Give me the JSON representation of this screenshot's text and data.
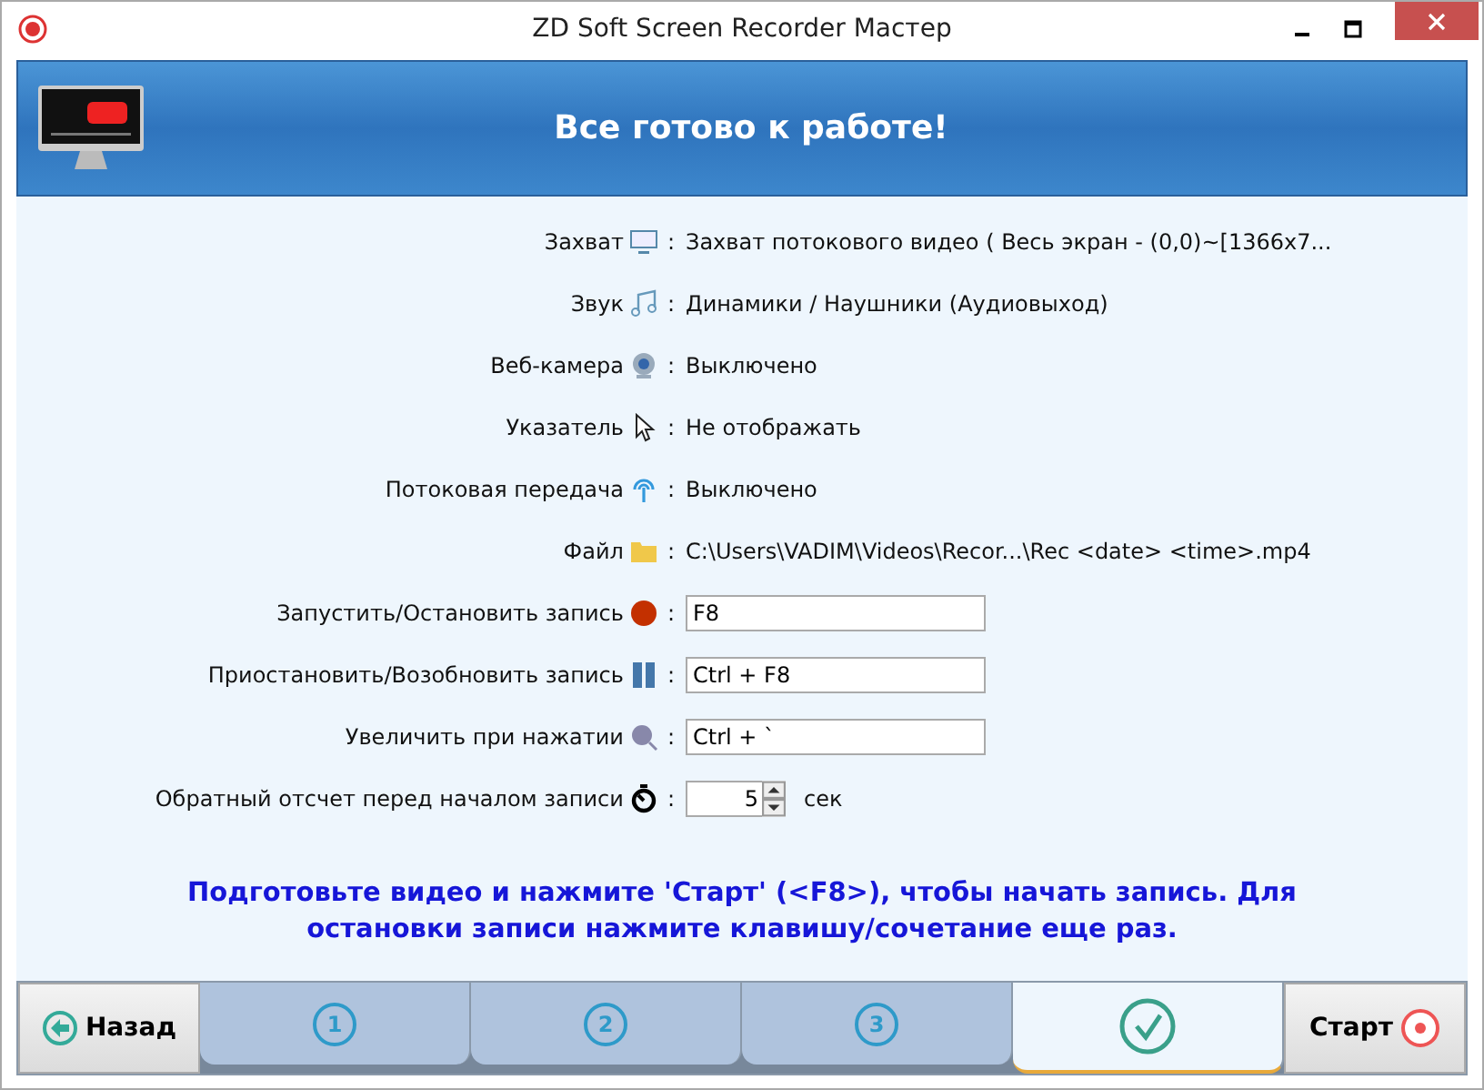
{
  "window": {
    "title": "ZD Soft Screen Recorder Мастер"
  },
  "banner": {
    "title": "Все готово к работе!"
  },
  "rows": [
    {
      "kind": "info",
      "label": "Захват",
      "colon": ":",
      "value": "Захват потокового видео ( Весь экран - (0,0)~[1366x7..."
    },
    {
      "kind": "info",
      "label": "Звук",
      "colon": ":",
      "value": "Динамики / Наушники (Аудиовыход)"
    },
    {
      "kind": "info",
      "label": "Веб-камера",
      "colon": ":",
      "value": "Выключено"
    },
    {
      "kind": "info",
      "label": "Указатель",
      "colon": ":",
      "value": "Не отображать"
    },
    {
      "kind": "info",
      "label": "Потоковая передача",
      "colon": ":",
      "value": "Выключено"
    },
    {
      "kind": "info",
      "label": "Файл",
      "colon": ":",
      "value": "C:\\Users\\VADIM\\Videos\\Recor...\\Rec <date> <time>.mp4"
    },
    {
      "kind": "field",
      "label": "Запустить/Остановить запись",
      "colon": ":",
      "value": "F8"
    },
    {
      "kind": "field",
      "label": "Приостановить/Возобновить запись",
      "colon": ":",
      "value": "Ctrl + F8"
    },
    {
      "kind": "field",
      "label": "Увеличить при нажатии",
      "colon": ":",
      "value": "Ctrl + `"
    },
    {
      "kind": "spinner",
      "label": "Обратный отсчет перед началом записи",
      "colon": ":",
      "value": "5",
      "unit": "сек"
    }
  ],
  "message": "Подготовьте видео и нажмите 'Старт' (<F8>), чтобы начать запись. Для остановки записи нажмите клавишу/сочетание еще раз.",
  "back_button": "Назад",
  "steps": [
    {
      "kind": "number",
      "label": "1",
      "selected": false
    },
    {
      "kind": "number",
      "label": "2",
      "selected": false
    },
    {
      "kind": "number",
      "label": "3",
      "selected": false
    },
    {
      "kind": "done",
      "selected": true
    }
  ],
  "start_button": "Старт"
}
